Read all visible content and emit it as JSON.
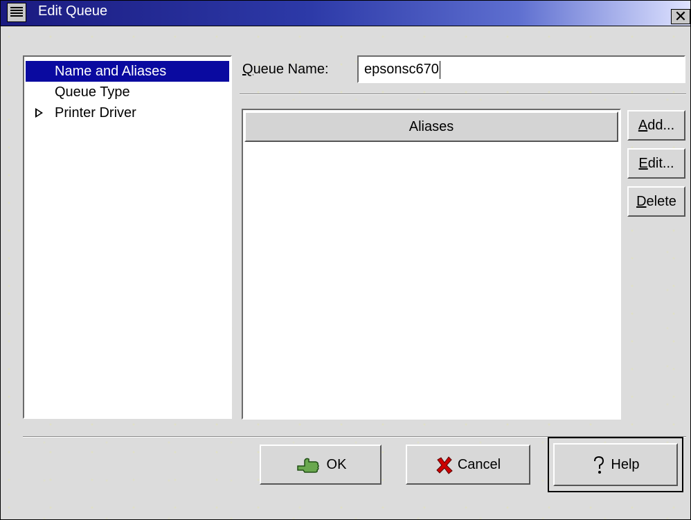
{
  "window": {
    "title": "Edit Queue",
    "close_glyph": "✕"
  },
  "tree": {
    "items": [
      {
        "label": "Name and Aliases",
        "selected": true,
        "expandable": false
      },
      {
        "label": "Queue Type",
        "selected": false,
        "expandable": false
      },
      {
        "label": "Printer Driver",
        "selected": false,
        "expandable": true
      }
    ]
  },
  "queue_name": {
    "label_mnemonic": "Q",
    "label_rest": "ueue Name:",
    "value": "epsonsc670"
  },
  "aliases": {
    "column_header": "Aliases",
    "rows": []
  },
  "side_buttons": {
    "add": {
      "mnemonic": "A",
      "rest": "dd..."
    },
    "edit": {
      "mnemonic": "E",
      "rest": "dit..."
    },
    "delete": {
      "mnemonic": "D",
      "rest": "elete"
    }
  },
  "footer": {
    "ok_label": "OK",
    "cancel_label": "Cancel",
    "help_label": "Help"
  },
  "icons": {
    "ok": "ok-hand-icon",
    "cancel": "red-x-icon",
    "help": "question-mark-icon",
    "menu": "window-menu-icon",
    "close": "close-icon"
  },
  "colors": {
    "selection": "#0a0aa0",
    "titlebar_start": "#1a1a80",
    "cancel_x": "#cc0000"
  }
}
